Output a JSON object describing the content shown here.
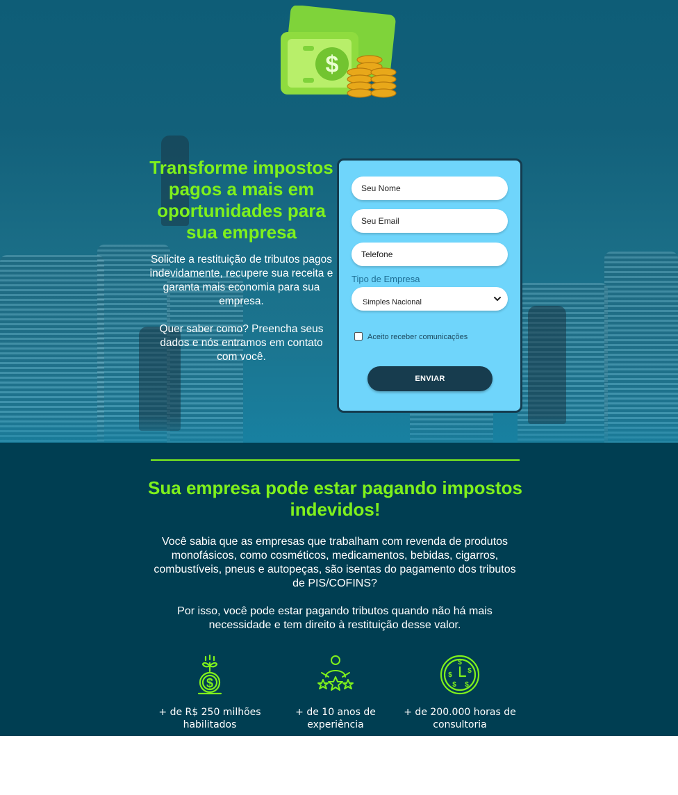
{
  "hero": {
    "title": "Transforme impostos pagos a mais em oportunidades para sua empresa",
    "description": "Solicite a restituição de tributos pagos indevidamente, recupere sua receita e garanta mais economia para sua empresa.",
    "cta_text": "Quer saber como? Preencha seus dados e nós entramos em contato com você."
  },
  "form": {
    "name_placeholder": "Seu Nome",
    "email_placeholder": "Seu Email",
    "phone_placeholder": "Telefone",
    "company_type_label": "Tipo de Empresa",
    "company_type_value": "Simples Nacional",
    "consent_label": "Aceito receber comunicações",
    "consent_checked": false,
    "submit_label": "ENVIAR"
  },
  "info": {
    "title": "Sua empresa pode estar pagando impostos indevidos!",
    "paragraph1": "Você sabia que as empresas que trabalham com revenda de produtos monofásicos, como cosméticos, medicamentos, bebidas, cigarros, combustíveis, pneus e autopeças, são isentas do pagamento dos tributos de PIS/COFINS?",
    "paragraph2": "Por isso, você pode estar pagando tributos quando não há mais necessidade e tem direito à restituição desse valor."
  },
  "stats": [
    {
      "icon": "money-plant-icon",
      "label": "+ de R$ 250 milhões habilitados"
    },
    {
      "icon": "person-stars-icon",
      "label": "+ de 10 anos de experiência"
    },
    {
      "icon": "money-clock-icon",
      "label": "+ de 200.000 horas de consultoria"
    }
  ],
  "colors": {
    "accent": "#7ff11c",
    "hero_bg": "#12607a",
    "section_bg": "#003e52",
    "form_bg": "#6fd5fb",
    "button_bg": "#173c4e"
  }
}
